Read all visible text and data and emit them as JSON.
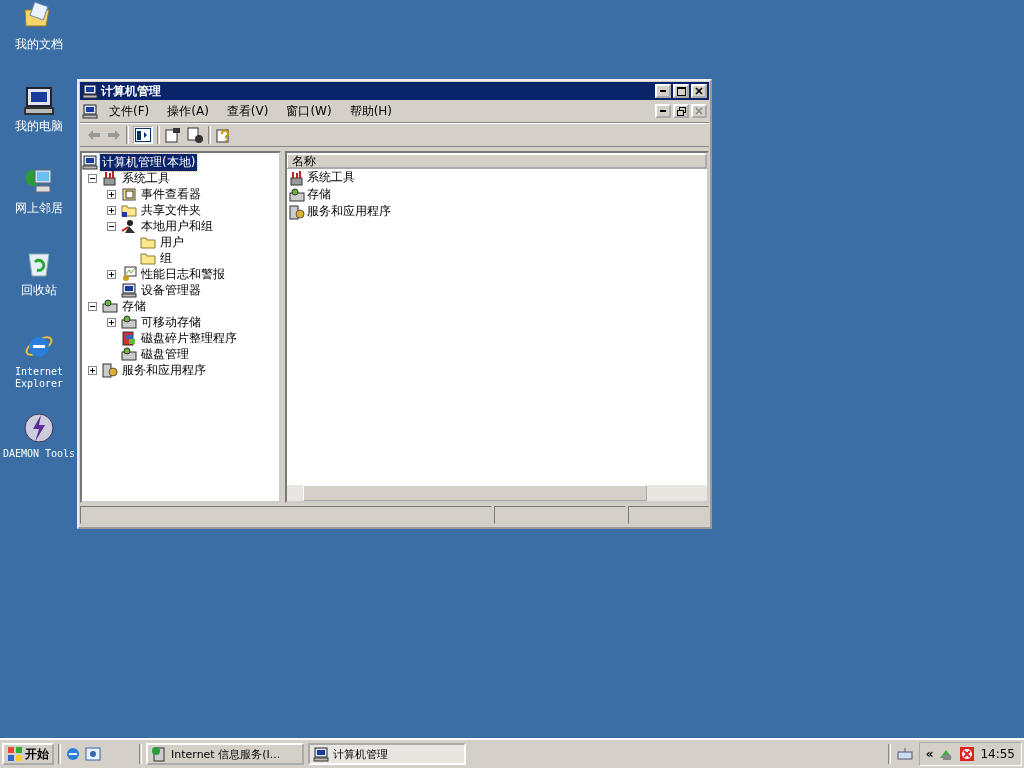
{
  "desktop_icons": [
    {
      "label": "我的文档"
    },
    {
      "label": "我的电脑"
    },
    {
      "label": "网上邻居"
    },
    {
      "label": "回收站"
    },
    {
      "label": "Internet Explorer"
    },
    {
      "label": "DAEMON Tools"
    }
  ],
  "window": {
    "title": "计算机管理",
    "menu": [
      "文件(F)",
      "操作(A)",
      "查看(V)",
      "窗口(W)",
      "帮助(H)"
    ],
    "tree": [
      {
        "label": "计算机管理(本地)",
        "selected": true,
        "children": [
          {
            "label": "系统工具",
            "selected": false,
            "expanded": true,
            "children": [
              {
                "label": "事件查看器",
                "selected": false,
                "expanded": false
              },
              {
                "label": "共享文件夹",
                "selected": false,
                "expanded": false
              },
              {
                "label": "本地用户和组",
                "selected": false,
                "expanded": true,
                "children": [
                  {
                    "label": "用户",
                    "selected": false
                  },
                  {
                    "label": "组",
                    "selected": false
                  }
                ]
              },
              {
                "label": "性能日志和警报",
                "selected": false,
                "expanded": false
              },
              {
                "label": "设备管理器",
                "selected": false
              }
            ]
          },
          {
            "label": "存储",
            "selected": false,
            "expanded": true,
            "children": [
              {
                "label": "可移动存储",
                "selected": false,
                "expanded": false
              },
              {
                "label": "磁盘碎片整理程序",
                "selected": false
              },
              {
                "label": "磁盘管理",
                "selected": false
              }
            ]
          },
          {
            "label": "服务和应用程序",
            "selected": false,
            "expanded": false
          }
        ]
      }
    ],
    "list": {
      "columns": [
        "名称"
      ],
      "rows": [
        {
          "name": "系统工具"
        },
        {
          "name": "存储"
        },
        {
          "name": "服务和应用程序"
        }
      ]
    }
  },
  "taskbar": {
    "start": "开始",
    "tasks": [
      {
        "label": "Internet 信息服务(I...",
        "selected": false
      },
      {
        "label": "计算机管理",
        "selected": true
      }
    ],
    "tray_toggle": "«",
    "clock": "14:55"
  }
}
